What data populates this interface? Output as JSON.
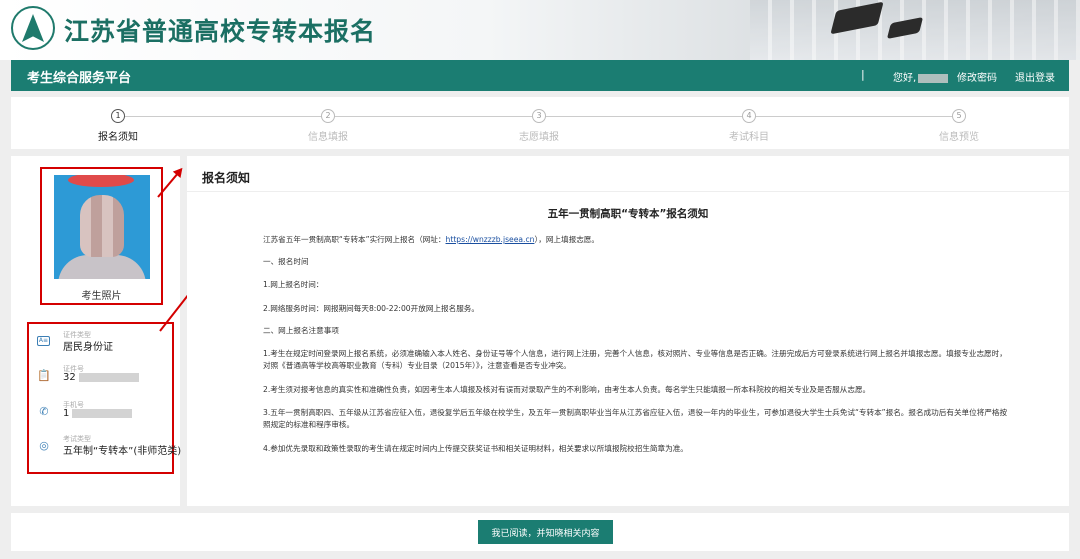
{
  "site": {
    "title": "江苏省普通高校专转本报名"
  },
  "nav": {
    "platform": "考生综合服务平台",
    "separator": "|",
    "greeting": "您好,",
    "change_password": "修改密码",
    "logout": "退出登录"
  },
  "steps": [
    {
      "num": "1",
      "label": "报名须知",
      "active": true
    },
    {
      "num": "2",
      "label": "信息填报",
      "active": false
    },
    {
      "num": "3",
      "label": "志愿填报",
      "active": false
    },
    {
      "num": "4",
      "label": "考试科目",
      "active": false
    },
    {
      "num": "5",
      "label": "信息预览",
      "active": false
    }
  ],
  "profile": {
    "photo_label": "考生照片",
    "items": [
      {
        "caption": "证件类型",
        "value": "居民身份证",
        "icon": "id-card-icon"
      },
      {
        "caption": "证件号",
        "value": "32",
        "icon": "clipboard-icon"
      },
      {
        "caption": "手机号",
        "value": "1",
        "icon": "phone-icon"
      },
      {
        "caption": "考试类型",
        "value": "五年制“专转本”(非师范类)",
        "icon": "exam-type-icon"
      }
    ]
  },
  "notice": {
    "heading": "报名须知",
    "title": "五年一贯制高职“专转本”报名须知",
    "intro_before": "江苏省五年一贯制高职“专转本”实行网上报名（网址：",
    "url": "https://wnzzzb.jseea.cn",
    "intro_after": "），网上填报志愿。",
    "s1": "一、报名时间",
    "p1": "1.网上报名时间：",
    "p2": "2.网络服务时间：网报期间每天8:00-22:00开放网上报名服务。",
    "s2": "二、网上报名注意事项",
    "p3": "1.考生在规定时间登录网上报名系统，必须准确输入本人姓名、身份证号等个人信息，进行网上注册，完善个人信息，核对照片、专业等信息是否正确。注册完成后方可登录系统进行网上报名并填报志愿。填报专业志愿时，对照《普通高等学校高等职业教育（专科）专业目录（2015年）》，注意查看是否专业冲突。",
    "p4": "2.考生须对报考信息的真实性和准确性负责，如因考生本人填报及核对有误而对录取产生的不利影响，由考生本人负责。每名学生只能填报一所本科院校的相关专业及是否服从志愿。",
    "p5": "3.五年一贯制高职四、五年级从江苏省应征入伍，退役复学后五年级在校学生，及五年一贯制高职毕业当年从江苏省应征入伍，退役一年内的毕业生，可参加退役大学生士兵免试“专转本”报名。报名成功后有关单位将严格按照规定的标准和程序审核。",
    "p6": "4.参加优先录取和政策性录取的考生请在规定时间内上传提交获奖证书和相关证明材料，相关要求以所填报院校招生简章为准。"
  },
  "footer": {
    "agree_button": "我已阅读，并知晓相关内容"
  },
  "colors": {
    "primary": "#1b7d72",
    "highlight": "#d40000"
  }
}
